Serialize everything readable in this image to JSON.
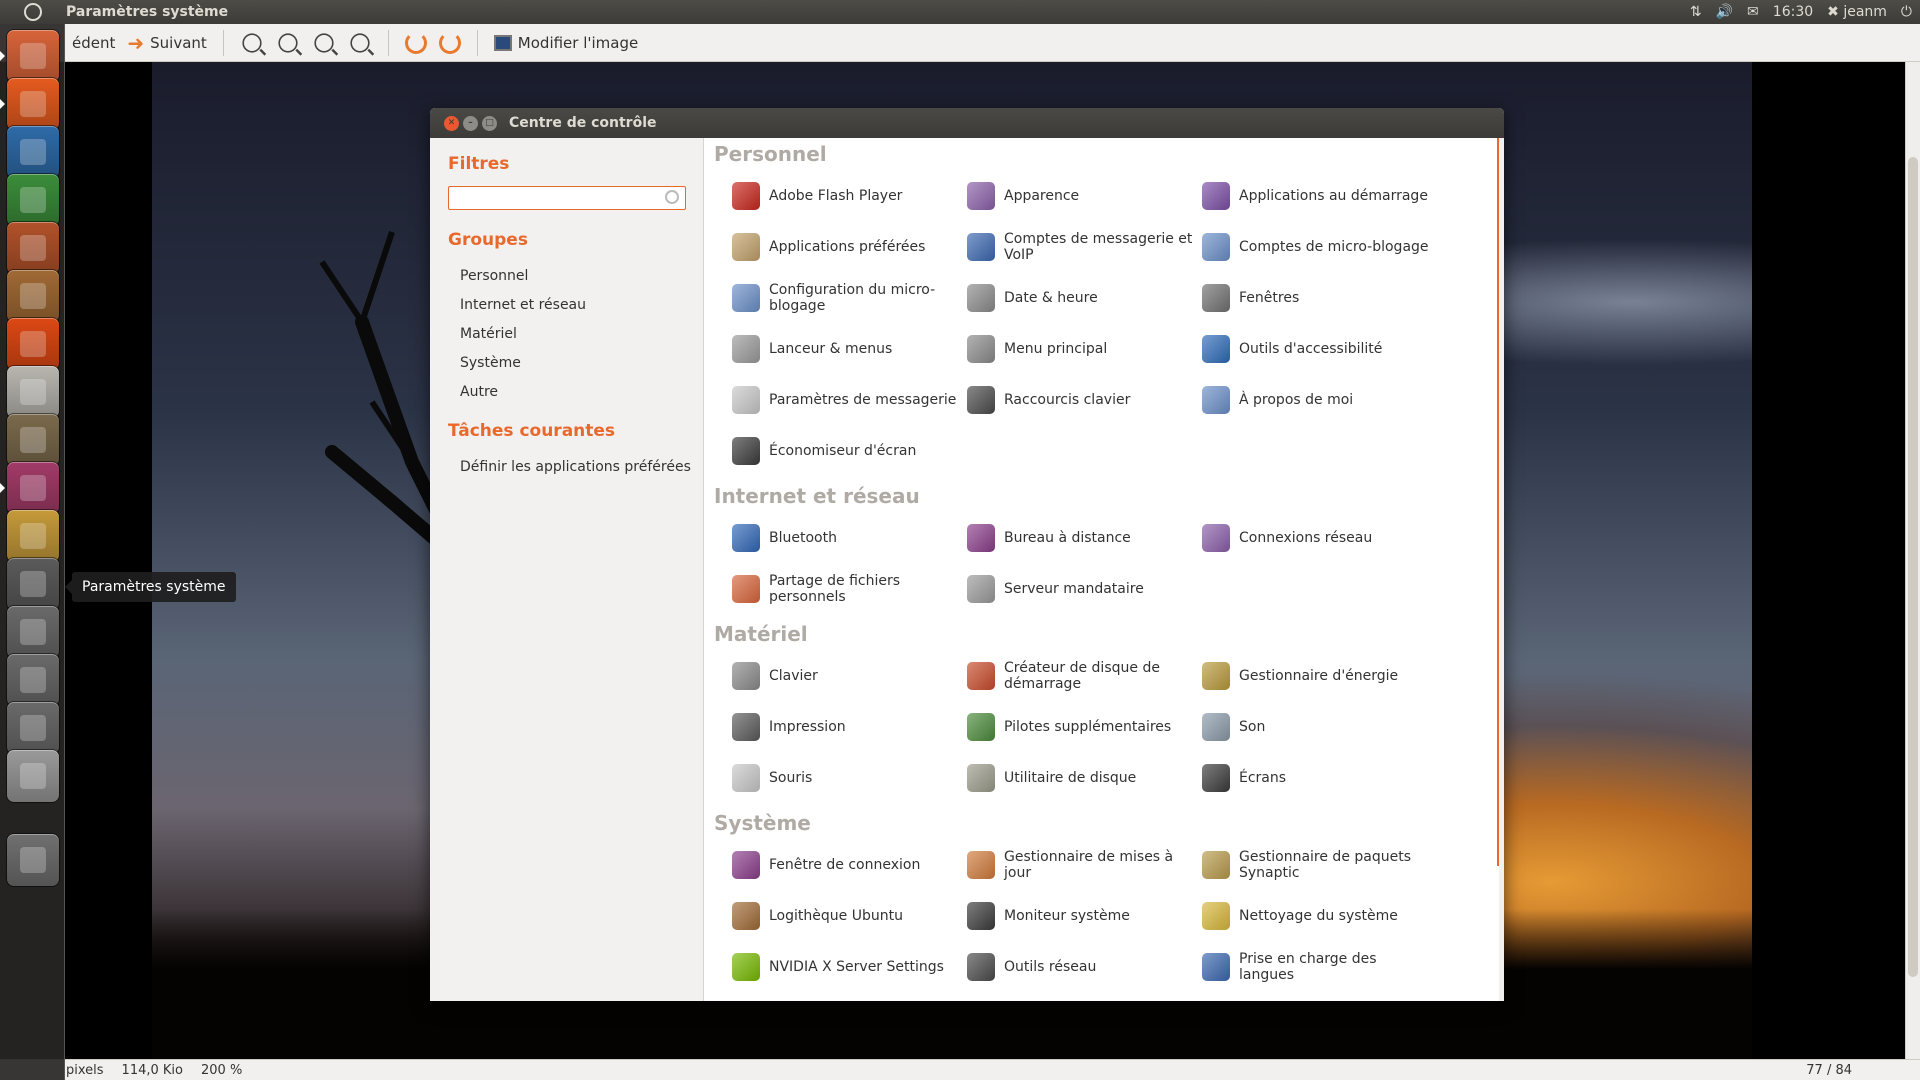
{
  "top_panel": {
    "app_title": "Paramètres système",
    "time": "16:30",
    "user": "jeanm"
  },
  "viewer_toolbar": {
    "prev_label": "édent",
    "next_label": "Suivant",
    "edit_label": "Modifier l'image"
  },
  "status_bar": {
    "dims": "pixels",
    "size": "114,0 Kio",
    "zoom": "200 %",
    "page": "77 / 84"
  },
  "launcher": {
    "tooltip": "Paramètres système",
    "items": [
      {
        "name": "home-folder",
        "color": "#d8643a"
      },
      {
        "name": "firefox",
        "color": "#e55b1f"
      },
      {
        "name": "writer",
        "color": "#2e6ba8"
      },
      {
        "name": "calc",
        "color": "#3b8d3b"
      },
      {
        "name": "impress",
        "color": "#b1522a"
      },
      {
        "name": "ubuntu-software",
        "color": "#a06a35"
      },
      {
        "name": "ubuntu-one",
        "color": "#dd4814"
      },
      {
        "name": "camera",
        "color": "#b9b6b0"
      },
      {
        "name": "gimp",
        "color": "#7b6a4c"
      },
      {
        "name": "system-settings",
        "color": "#a23b68"
      },
      {
        "name": "shotwell",
        "color": "#c59a3a"
      },
      {
        "name": "workspaces",
        "color": "#5b5b5b"
      },
      {
        "name": "zoom-in",
        "color": "#6a6a6a"
      },
      {
        "name": "zoom-search",
        "color": "#6a6a6a"
      },
      {
        "name": "usb-drive",
        "color": "#6a6a6a"
      },
      {
        "name": "removable-drive",
        "color": "#9a9a9a"
      },
      {
        "name": "trash",
        "color": "#707070"
      }
    ]
  },
  "window": {
    "title": "Centre de contrôle",
    "sidebar": {
      "filters_heading": "Filtres",
      "filter_value": "",
      "groups_heading": "Groupes",
      "groups": [
        "Personnel",
        "Internet et réseau",
        "Matériel",
        "Système",
        "Autre"
      ],
      "tasks_heading": "Tâches courantes",
      "tasks": [
        "Définir les applications préférées"
      ]
    },
    "categories": [
      {
        "title": "Personnel",
        "items": [
          {
            "label": "Adobe Flash Player",
            "color": "#c8261c"
          },
          {
            "label": "Apparence",
            "color": "#8a5fa8"
          },
          {
            "label": "Applications au démarrage",
            "color": "#7b4ea5"
          },
          {
            "label": "Applications préférées",
            "color": "#c2a06a"
          },
          {
            "label": "Comptes de messagerie et VoIP",
            "color": "#3a67b0"
          },
          {
            "label": "Comptes de micro-blogage",
            "color": "#6a8fc8"
          },
          {
            "label": "Configuration du micro-blogage",
            "color": "#6a8fc8"
          },
          {
            "label": "Date & heure",
            "color": "#8a8a8a"
          },
          {
            "label": "Fenêtres",
            "color": "#707070"
          },
          {
            "label": "Lanceur & menus",
            "color": "#9a9a9a"
          },
          {
            "label": "Menu principal",
            "color": "#8a8a8a"
          },
          {
            "label": "Outils d'accessibilité",
            "color": "#2d6ab8"
          },
          {
            "label": "Paramètres de messagerie",
            "color": "#c8c8c8"
          },
          {
            "label": "Raccourcis clavier",
            "color": "#4a4a4a"
          },
          {
            "label": "À propos de moi",
            "color": "#6a8fc8"
          },
          {
            "label": "Économiseur d'écran",
            "color": "#3a3a3a"
          }
        ]
      },
      {
        "title": "Internet et réseau",
        "items": [
          {
            "label": "Bluetooth",
            "color": "#3067b7"
          },
          {
            "label": "Bureau à distance",
            "color": "#8a3d8a"
          },
          {
            "label": "Connexions réseau",
            "color": "#8a5fa8"
          },
          {
            "label": "Partage de fichiers personnels",
            "color": "#d8643a"
          },
          {
            "label": "Serveur mandataire",
            "color": "#9a9a9a"
          }
        ]
      },
      {
        "title": "Matériel",
        "items": [
          {
            "label": "Clavier",
            "color": "#8a8a8a"
          },
          {
            "label": "Créateur de disque de démarrage",
            "color": "#c84a2a"
          },
          {
            "label": "Gestionnaire d'énergie",
            "color": "#b89a3a"
          },
          {
            "label": "Impression",
            "color": "#5a5a5a"
          },
          {
            "label": "Pilotes supplémentaires",
            "color": "#4a8a3a"
          },
          {
            "label": "Son",
            "color": "#8a9aa8"
          },
          {
            "label": "Souris",
            "color": "#c8c8c8"
          },
          {
            "label": "Utilitaire de disque",
            "color": "#9a9a8a"
          },
          {
            "label": "Écrans",
            "color": "#3a3a3a"
          }
        ]
      },
      {
        "title": "Système",
        "items": [
          {
            "label": "Fenêtre de connexion",
            "color": "#8a3d8a"
          },
          {
            "label": "Gestionnaire de mises à jour",
            "color": "#d07a3a"
          },
          {
            "label": "Gestionnaire de paquets Synaptic",
            "color": "#b89a4a"
          },
          {
            "label": "Logithèque Ubuntu",
            "color": "#a06a35"
          },
          {
            "label": "Moniteur système",
            "color": "#3a3a3a"
          },
          {
            "label": "Nettoyage du système",
            "color": "#d8b83a"
          },
          {
            "label": "NVIDIA X Server Settings",
            "color": "#76b900"
          },
          {
            "label": "Outils réseau",
            "color": "#4a4a4a"
          },
          {
            "label": "Prise en charge des langues",
            "color": "#3a67b0"
          }
        ]
      }
    ]
  }
}
